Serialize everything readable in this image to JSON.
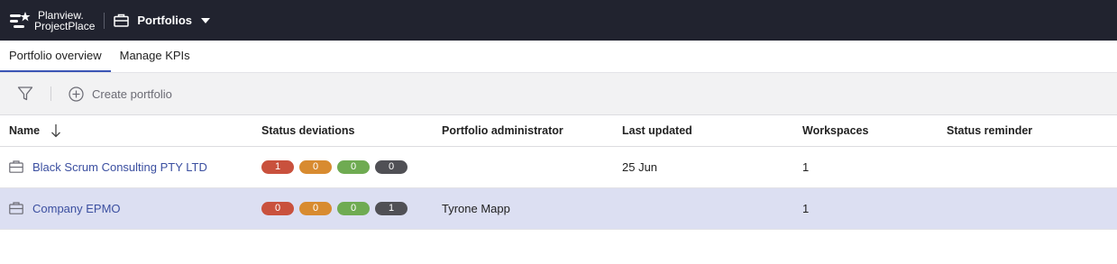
{
  "topbar": {
    "logo_line1": "Planview.",
    "logo_line2": "ProjectPlace",
    "module_label": "Portfolios"
  },
  "tabs": [
    {
      "label": "Portfolio overview",
      "active": true
    },
    {
      "label": "Manage KPIs",
      "active": false
    }
  ],
  "toolbar": {
    "create_label": "Create portfolio"
  },
  "table": {
    "headers": {
      "name": "Name",
      "status": "Status deviations",
      "admin": "Portfolio administrator",
      "updated": "Last updated",
      "workspaces": "Workspaces",
      "reminder": "Status reminder"
    },
    "rows": [
      {
        "name": "Black Scrum Consulting PTY LTD",
        "status": {
          "red": "1",
          "orange": "0",
          "green": "0",
          "dark": "0"
        },
        "admin": "",
        "updated": "25 Jun",
        "workspaces": "1",
        "reminder": "",
        "selected": false
      },
      {
        "name": "Company EPMO",
        "status": {
          "red": "0",
          "orange": "0",
          "green": "0",
          "dark": "1"
        },
        "admin": "Tyrone Mapp",
        "updated": "",
        "workspaces": "1",
        "reminder": "",
        "selected": true
      }
    ]
  },
  "colors": {
    "topbar": "#21232f",
    "accent": "#3b55b5",
    "link": "#3b4fa0",
    "selected_row": "#dcdff2",
    "status_red": "#c9513d",
    "status_orange": "#d88b30",
    "status_green": "#6fab52",
    "status_dark": "#505055"
  }
}
